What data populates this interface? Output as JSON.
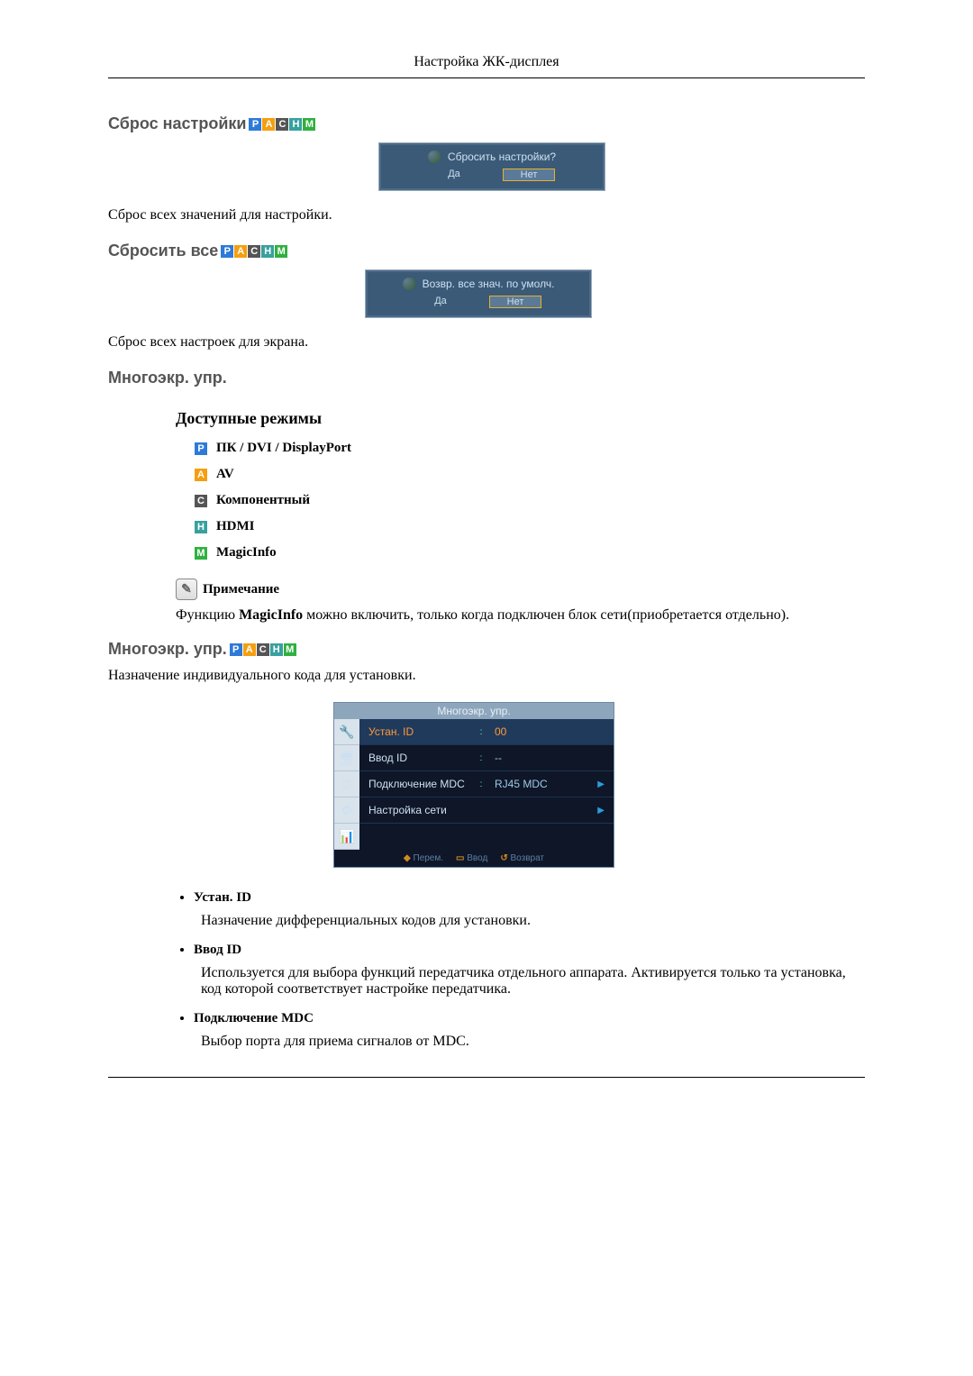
{
  "page_header": "Настройка ЖК-дисплея",
  "badges": {
    "p": "P",
    "a": "A",
    "c": "C",
    "h": "H",
    "m": "M"
  },
  "sec_reset_settings": {
    "title": "Сброс настройки",
    "dialog": {
      "q": "Сбросить настройки?",
      "yes": "Да",
      "no": "Нет"
    },
    "desc": "Сброс всех значений для настройки."
  },
  "sec_reset_all": {
    "title": "Сбросить все",
    "dialog": {
      "q": "Возвр. все знач. по умолч.",
      "yes": "Да",
      "no": "Нет"
    },
    "desc": "Сброс всех настроек для экрана."
  },
  "sec_multi_title": "Многоэкр. упр.",
  "sec_modes": {
    "title": "Доступные режимы",
    "items": [
      "ПК / DVI / DisplayPort",
      "AV",
      "Компонентный",
      "HDMI",
      "MagicInfo"
    ]
  },
  "note": {
    "title": "Примечание",
    "body_prefix": "Функцию ",
    "body_bold": "MagicInfo",
    "body_suffix": " можно включить, только когда подключен блок сети(приобретается отдельно)."
  },
  "sec_multi2": {
    "title": "Многоэкр. упр.",
    "desc": "Назначение индивидуального кода для установки."
  },
  "osd_menu": {
    "title": "Многоэкр. упр.",
    "rows": [
      {
        "label": "Устан. ID",
        "value": "00",
        "colon": ":",
        "hot": true,
        "arrow": false
      },
      {
        "label": "Ввод ID",
        "value": "--",
        "colon": ":",
        "hot": false,
        "arrow": false
      },
      {
        "label": "Подключение MDC",
        "value": "RJ45 MDC",
        "colon": ":",
        "hot": false,
        "arrow": true
      },
      {
        "label": "Настройка сети",
        "value": "",
        "colon": "",
        "hot": false,
        "arrow": true
      }
    ],
    "footer": {
      "move": "Перем.",
      "enter": "Ввод",
      "back": "Возврат"
    }
  },
  "details": [
    {
      "title": "Устан. ID",
      "desc": "Назначение дифференциальных кодов для установки."
    },
    {
      "title": "Ввод ID",
      "desc": "Используется для выбора функций передатчика отдельного аппарата. Активируется только та установка, код которой соответствует настройке передатчика."
    },
    {
      "title": "Подключение MDC",
      "desc": "Выбор порта для приема сигналов от MDC."
    }
  ]
}
